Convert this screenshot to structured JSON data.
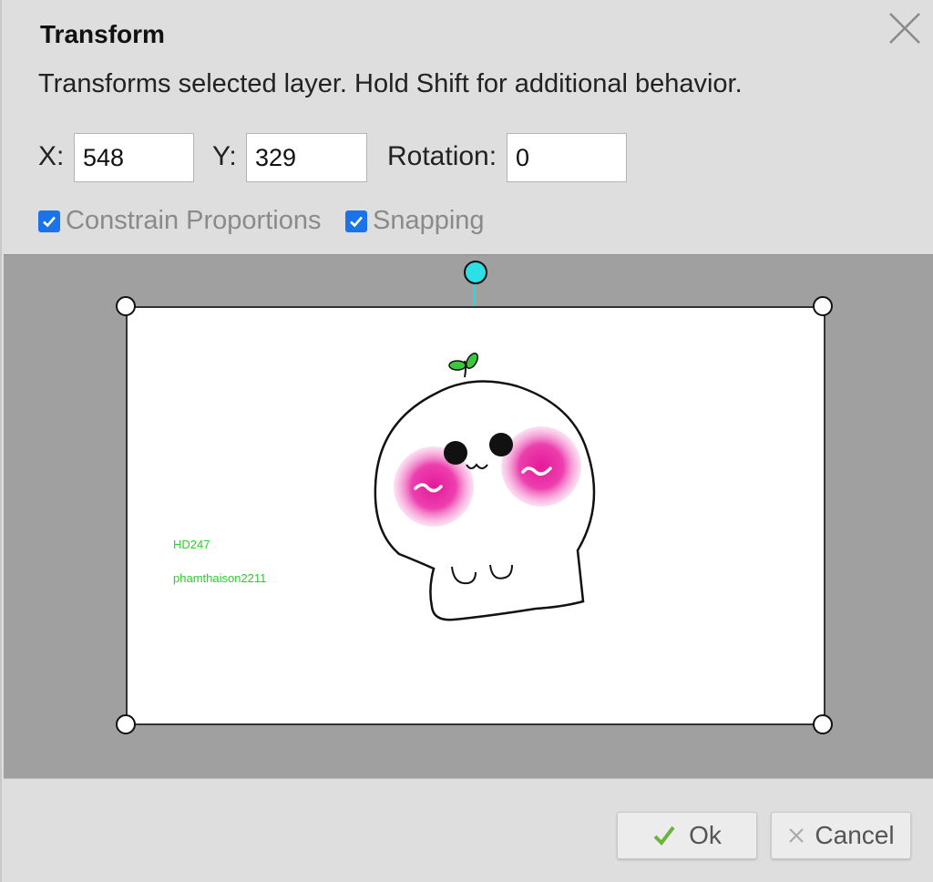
{
  "dialog": {
    "title": "Transform",
    "description": "Transforms selected layer. Hold Shift for additional behavior."
  },
  "fields": {
    "x_label": "X:",
    "x_value": "548",
    "y_label": "Y:",
    "y_value": "329",
    "rotation_label": "Rotation:",
    "rotation_value": "0"
  },
  "options": {
    "constrain_label": "Constrain Proportions",
    "constrain_checked": true,
    "snapping_label": "Snapping",
    "snapping_checked": true
  },
  "canvas": {
    "watermark_line1": "HD247",
    "watermark_line2": "phamthaison2211"
  },
  "buttons": {
    "ok_label": "Ok",
    "cancel_label": "Cancel"
  },
  "icons": {
    "close": "close-icon",
    "ok": "checkmark-icon",
    "cancel": "x-icon",
    "checkbox": "checkmark-icon"
  },
  "colors": {
    "accent": "#1a73e8",
    "rotation_handle": "#2de0e6",
    "ok_check": "#6cb33e",
    "watermark": "#29d12d",
    "blush": "#e6189a",
    "sprout": "#3cc83c"
  }
}
